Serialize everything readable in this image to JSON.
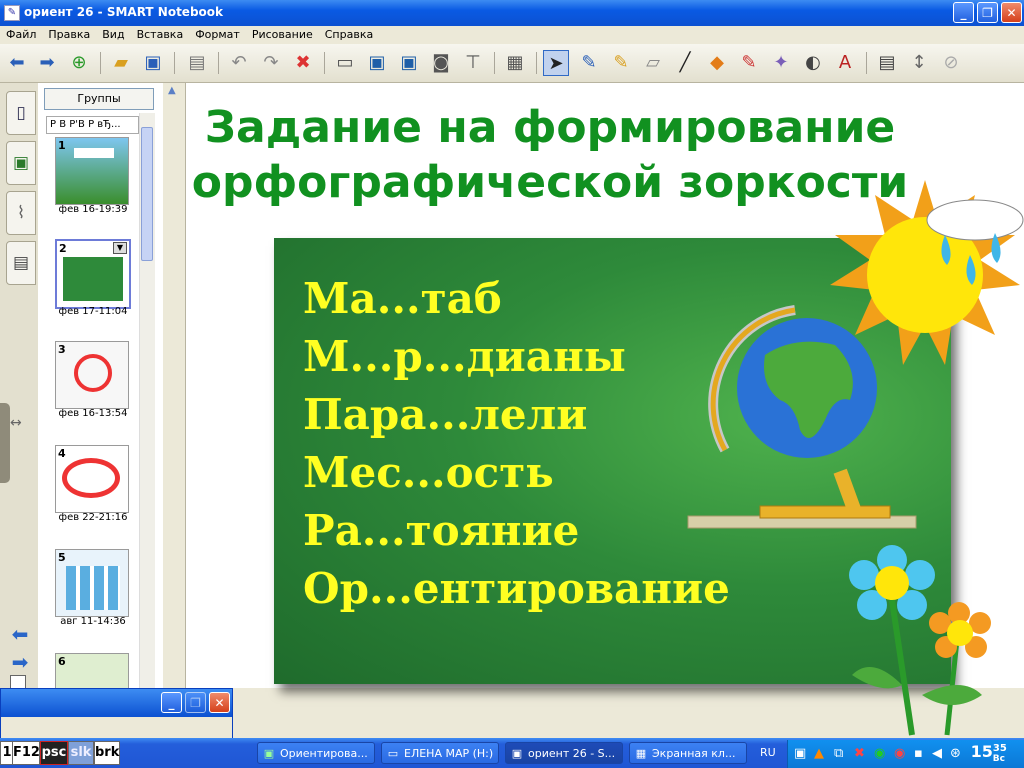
{
  "window": {
    "title": "ориент 26 - SMART Notebook",
    "min": "_",
    "max": "❐",
    "close": "✕"
  },
  "menu": [
    "Файл",
    "Правка",
    "Вид",
    "Вставка",
    "Формат",
    "Рисование",
    "Справка"
  ],
  "sorter": {
    "groups_button": "Группы",
    "group_row": "Р В Р'В Р вЂ...",
    "pages": [
      {
        "num": "1",
        "date": "фев 16-19:39"
      },
      {
        "num": "2",
        "date": "фев 17-11:04"
      },
      {
        "num": "3",
        "date": "фев 16-13:54"
      },
      {
        "num": "4",
        "date": "фев 22-21:16"
      },
      {
        "num": "5",
        "date": "авг 11-14:36"
      },
      {
        "num": "6",
        "date": ""
      }
    ]
  },
  "slide": {
    "title_line1": "Задание на формирование",
    "title_line2": "орфографической зоркости",
    "words": [
      "Ма...таб",
      "М...р...дианы",
      "Пара...лели",
      "Мес...ость",
      "Ра...тояние",
      "Ор...ентирование"
    ]
  },
  "hotkeys": [
    "1",
    "F12",
    "psc",
    "slk",
    "brk"
  ],
  "taskbar": {
    "tasks": [
      {
        "label": "Ориентирова...",
        "icon": "notebook-icon"
      },
      {
        "label": "ЕЛЕНА МАР (H:)",
        "icon": "drive-icon"
      },
      {
        "label": "ориент 26 - S...",
        "icon": "notebook-icon"
      },
      {
        "label": "Экранная кл...",
        "icon": "keyboard-icon"
      }
    ],
    "lang": "RU",
    "clock_hours": "15",
    "clock_minutes": "35",
    "clock_day": "Вс"
  },
  "colors": {
    "title_green": "#119120",
    "word_yellow": "#ffff22",
    "board_green": "#2e8a3a"
  }
}
